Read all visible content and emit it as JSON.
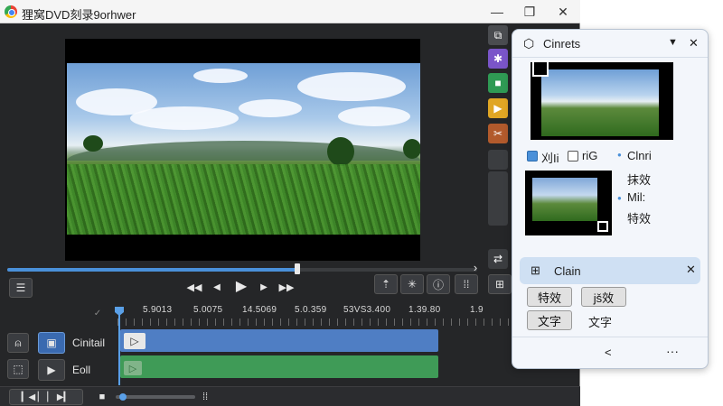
{
  "window": {
    "title": "狸窝DVD刻录9orhwer",
    "minimize": "—",
    "maximize": "❐",
    "close": "✕"
  },
  "playback": {
    "rewind": "◀◀",
    "step_back": "◀",
    "play": "▶",
    "step_forward": "▶",
    "fast_forward": "▶▶",
    "seek_progress": 0.62,
    "menu": "☰",
    "expand_icon": "›"
  },
  "timeline": {
    "ruler_check": "✓",
    "ticks": [
      "5.9013",
      "5.0075",
      "14.5069",
      "5.0.359",
      "53VS3.400",
      "1.39.80",
      "1.9"
    ],
    "tracks": [
      {
        "name": "Cinitail",
        "type": "video",
        "color": "#4f7ec4"
      },
      {
        "name": "Eoll",
        "type": "audio",
        "color": "#3f9b57"
      }
    ]
  },
  "panel": {
    "title": "Cinrets",
    "collapse_glyph": "▼",
    "close_glyph": "✕",
    "options": {
      "cb1_label": "刈Ii",
      "cb2_label": "riG"
    },
    "bullets": [
      "Clnri",
      "抹效",
      "Mil:",
      "特效"
    ],
    "section2": {
      "title": "Clain",
      "close_glyph": "✕"
    },
    "buttons": [
      "特效",
      "jš效"
    ],
    "row2": {
      "button": "文字",
      "text": "文字"
    },
    "footer": {
      "share": "<",
      "more": "···"
    }
  }
}
